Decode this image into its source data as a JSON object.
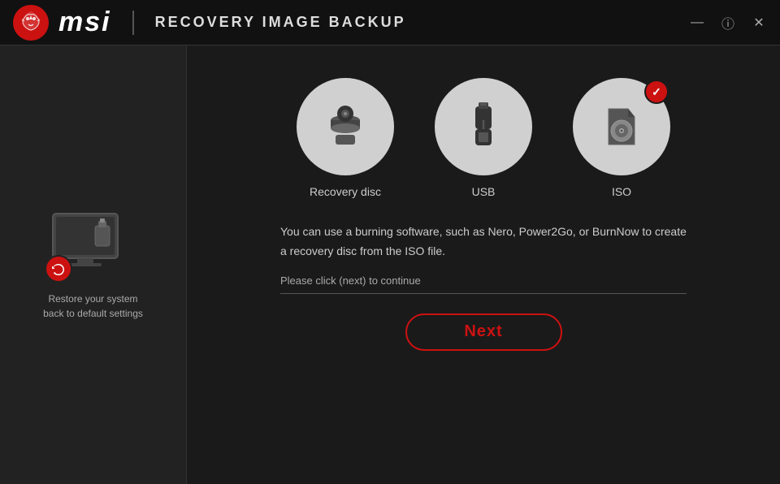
{
  "titlebar": {
    "logo_text": "msi",
    "title": "RECOVERY IMAGE BACKUP",
    "minimize_label": "—",
    "info_label": "ⓘ",
    "close_label": "✕"
  },
  "sidebar": {
    "label_line1": "Restore your system",
    "label_line2": "back to default settings"
  },
  "options": [
    {
      "id": "recovery-disc",
      "label": "Recovery disc",
      "selected": false,
      "icon": "disc"
    },
    {
      "id": "usb",
      "label": "USB",
      "selected": false,
      "icon": "usb"
    },
    {
      "id": "iso",
      "label": "ISO",
      "selected": true,
      "icon": "iso"
    }
  ],
  "description": {
    "text": "You can use a burning software, such as Nero, Power2Go, or BurnNow to create a recovery disc from the ISO file.",
    "status_text": "Please click (next) to continue"
  },
  "next_button": {
    "label": "Next"
  }
}
